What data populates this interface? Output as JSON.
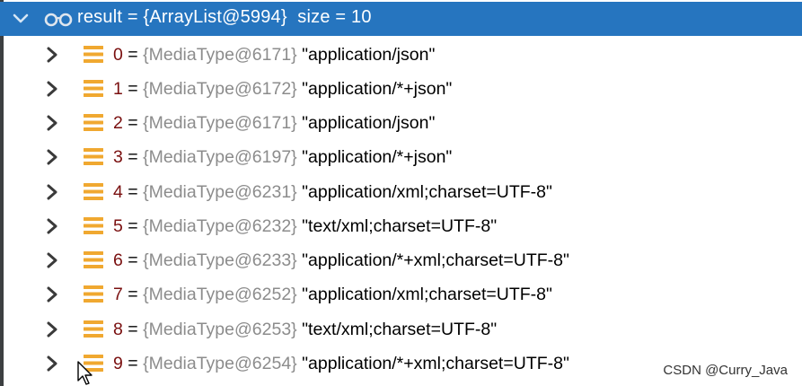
{
  "root": {
    "text": "result = {ArrayList@5994}  size = 10"
  },
  "items": [
    {
      "index": "0",
      "ref": "{MediaType@6171}",
      "value": "\"application/json\""
    },
    {
      "index": "1",
      "ref": "{MediaType@6172}",
      "value": "\"application/*+json\""
    },
    {
      "index": "2",
      "ref": "{MediaType@6171}",
      "value": "\"application/json\""
    },
    {
      "index": "3",
      "ref": "{MediaType@6197}",
      "value": "\"application/*+json\""
    },
    {
      "index": "4",
      "ref": "{MediaType@6231}",
      "value": "\"application/xml;charset=UTF-8\""
    },
    {
      "index": "5",
      "ref": "{MediaType@6232}",
      "value": "\"text/xml;charset=UTF-8\""
    },
    {
      "index": "6",
      "ref": "{MediaType@6233}",
      "value": "\"application/*+xml;charset=UTF-8\""
    },
    {
      "index": "7",
      "ref": "{MediaType@6252}",
      "value": "\"application/xml;charset=UTF-8\""
    },
    {
      "index": "8",
      "ref": "{MediaType@6253}",
      "value": "\"text/xml;charset=UTF-8\""
    },
    {
      "index": "9",
      "ref": "{MediaType@6254}",
      "value": "\"application/*+xml;charset=UTF-8\""
    }
  ],
  "separator": " = ",
  "watermark": "CSDN @Curry_Java",
  "icons": {
    "root_toggle": "chevron-down-icon",
    "root_type": "glasses-icon",
    "child_toggle": "chevron-right-icon",
    "child_type": "list-object-icon"
  },
  "colors": {
    "selection": "#2675bf",
    "index": "#7a1010",
    "reference": "#8c8c8c",
    "list_icon": "#f0a830"
  }
}
